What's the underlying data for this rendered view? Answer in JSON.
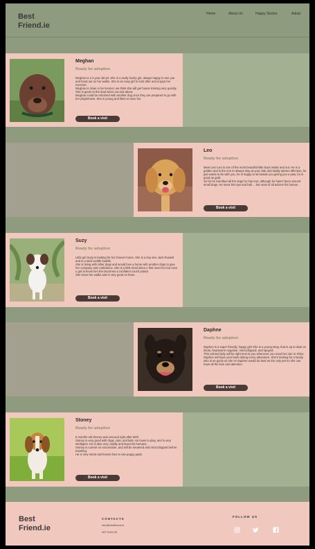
{
  "header": {
    "logo": "Best\nFriend.ie",
    "nav": [
      "Home",
      "About Us",
      "Happy Stories",
      "Adopt"
    ]
  },
  "dogs": [
    {
      "name": "Meghan",
      "status": "Ready for adoption",
      "description": "Meghan is a 3 year old pit. She is a really lovely girl, always happy to see you and head out on her walks. She is an easy girl to look after and enjoys her exercise.\nMeghan is clean in her kennel, we think she will get house training very quickly. She is good on the lead when out and about.\nMeghan could be rehomed with another dog once they are prepared to go with her playfulness. She is young and likes to have fun.",
      "button": "Book a visit"
    },
    {
      "name": "Leo",
      "status": "Ready for adoption",
      "description": "Meet Leo! Leo is one of the most beautiful little boys inside and out. He is a golden and is the one to always stay at your side and totally adores affection, he just wants to be with you, he is happy to sit beside you giving you a paw, he is good as gold.\nSo far he has liked all the dogs he has met, although he hasn't been around small dogs. He loves his toys and ball ... but most of all adores his human .",
      "button": "Book a visit"
    },
    {
      "name": "Suzy",
      "status": "Ready for adoption",
      "description": "Little girl Suzy is looking for her forever home. She is a tiny size Jack Russell and is a total cuddle buddie.\nShe is living with other dogs and would love a home with another dogs to give her company and confidence. She is a little timid when u first meet her but once u get to know her she becomes a confident couch potato.\nShe loves her walks and is very good on them.",
      "button": "Book a visit"
    },
    {
      "name": "Daphne",
      "status": "Ready for adoption",
      "description": "Daphne is a super friendly, happy girl! She is a young stray, that is up to date on shots, heartworm negative, microchipped, and spayed.\nThis colored lady will be right next to you whenever you need her rain or shine. Daphne will have your back during every adventure. She's looking for a family who is as goofy as she is! Daphne would do best as the only pet so she can have all the love and attention.",
      "button": "Book a visit"
    },
    {
      "name": "Stoney",
      "status": "Ready for adoption",
      "description": "5 months old Stoney was rescued right after birth.\nStoney is very good with dogs, cats, and kids. He loves to play, and is very intelligent. He is also very cuddly and loves his humans.\nStoney is current on vaccination, and will be neutered and microchipped before traveling.\nHe is very smart and knows how to use puppy pads.",
      "button": "Book a visit"
    }
  ],
  "footer": {
    "logo": "Best\nFriend.ie",
    "contacts_heading": "CONTACTS",
    "email": "info@bestfriend.ie",
    "phone": "087 0163 33",
    "follow_heading": "FOLLOW US",
    "social_icons": [
      "instagram-icon",
      "twitter-icon",
      "facebook-icon"
    ]
  },
  "colors": {
    "page_bg": "#8e9b7e",
    "band_light": "#a3b091",
    "band_gray": "#a4a08f",
    "card_bg": "#f0c8bd",
    "button_bg": "#4a3b37",
    "status_text": "#8c8c6e"
  }
}
